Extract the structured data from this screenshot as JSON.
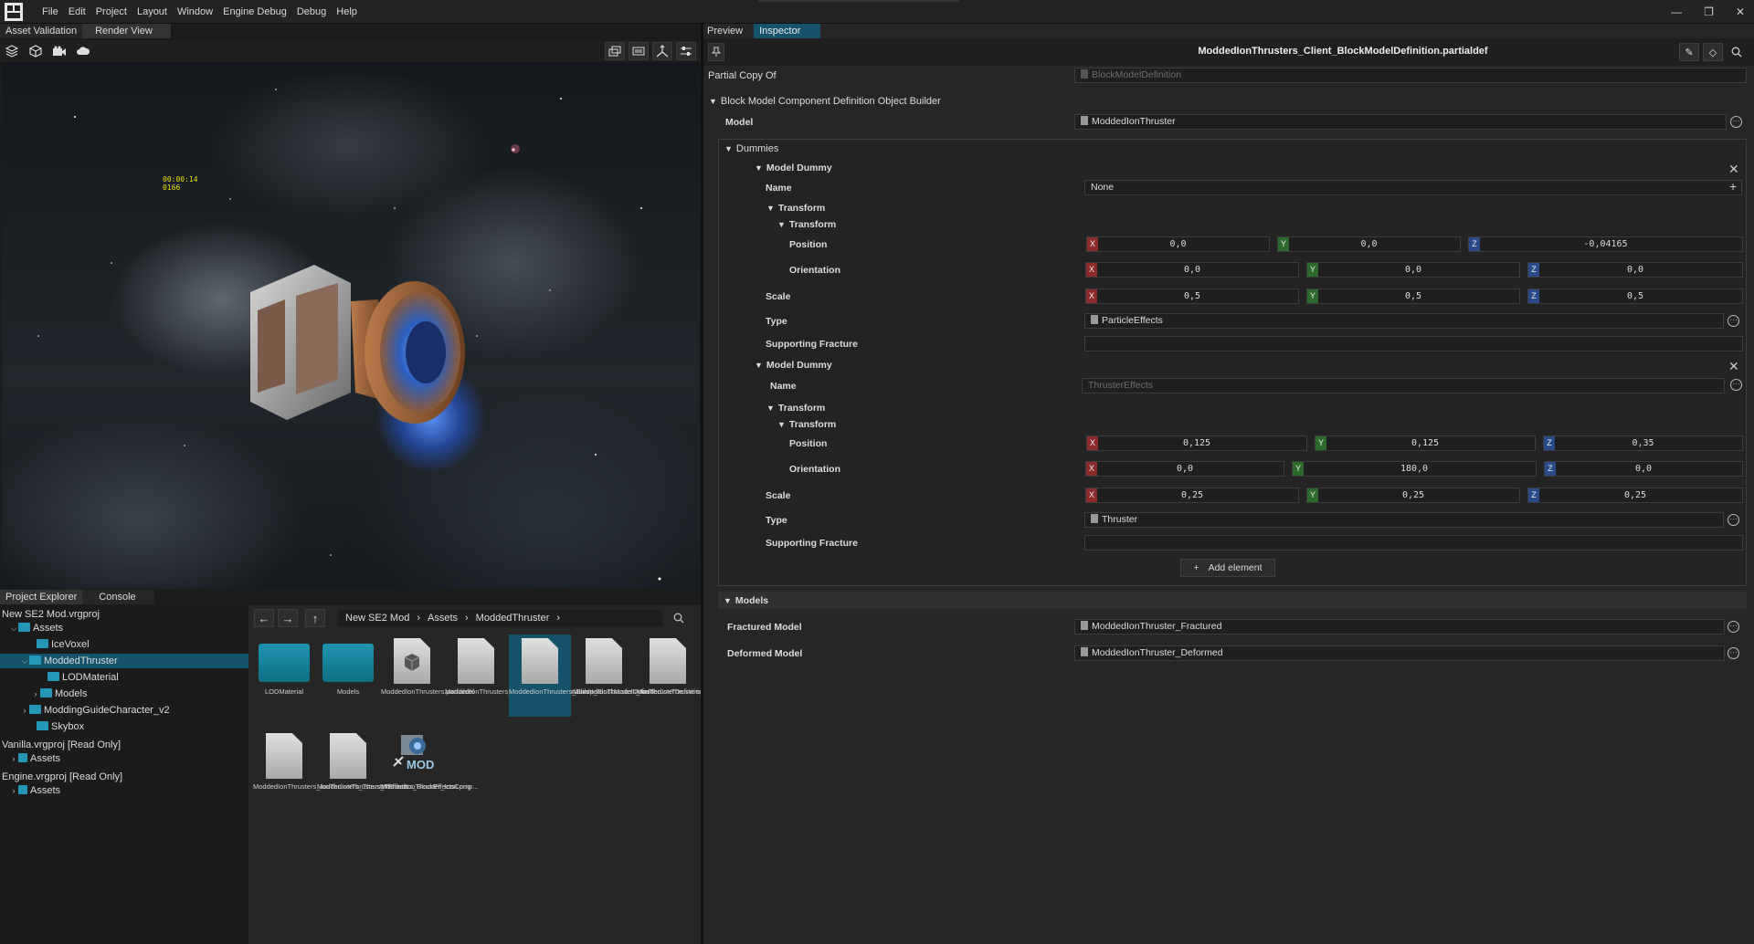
{
  "menu": [
    "File",
    "Edit",
    "Project",
    "Layout",
    "Window",
    "Engine Debug",
    "Debug",
    "Help"
  ],
  "window_controls": [
    "—",
    "❐",
    "✕"
  ],
  "viewport_tabs": [
    "Asset Validation",
    "Render View"
  ],
  "viewport": {
    "hud_line1": "00:00:14",
    "hud_line2": "0166",
    "left_tools": [
      "layers-icon",
      "cube-icon",
      "camera-icon",
      "cloud-icon"
    ],
    "right_tools": [
      "stack-icon",
      "keyboard-icon",
      "axes-icon",
      "sliders-icon"
    ]
  },
  "explorer_tabs": [
    "Project Explorer",
    "Console"
  ],
  "tree": {
    "project1": "New SE2 Mod.vrgproj",
    "assets1": "Assets",
    "icevoxel": "IceVoxel",
    "modded": "ModdedThruster",
    "lodmaterial": "LODMaterial",
    "models": "Models",
    "moddingguide": "ModdingGuideCharacter_v2",
    "skybox": "Skybox",
    "project2": "Vanilla.vrgproj [Read Only]",
    "assets2": "Assets",
    "project3": "Engine.vrgproj [Read Only]",
    "assets3": "Assets"
  },
  "browser": {
    "crumbs": [
      "New SE2 Mod",
      "Assets",
      "ModdedThruster"
    ],
    "items": [
      {
        "label": "LODMaterial",
        "kind": "folder"
      },
      {
        "label": "Models",
        "kind": "folder"
      },
      {
        "label": "ModdedIonThrusters.partialdef",
        "kind": "cube"
      },
      {
        "label": "ModdedIonThrusters_BreakableBlockDefinition.par...",
        "kind": "doc"
      },
      {
        "label": "ModdedIonThrusters_Client_BlockModelDefinition....",
        "kind": "doc"
      },
      {
        "label": "ModdedIonThrusters_IonThrusterDefinition.partiald...",
        "kind": "doc"
      },
      {
        "label": "ModdedIonThrusters_IonThrustersPowerableBlock...",
        "kind": "doc"
      },
      {
        "label": "ModdedIonThrusters_IonThrusters_ThrusterEffects...",
        "kind": "doc"
      },
      {
        "label": "ModdedIonThrusters_Thrusters_BlockEffectsComp...",
        "kind": "doc"
      },
      {
        "label": "ModdedIonThruster_Icon.png",
        "kind": "mod"
      }
    ],
    "mod_text": "MOD"
  },
  "inspector_tabs": [
    "Preview",
    "Inspector"
  ],
  "inspector": {
    "title": "ModdedIonThrusters_Client_BlockModelDefinition.partialdef",
    "partial_copy_label": "Partial Copy Of",
    "partial_copy_value": "BlockModelDefinition",
    "builder_label": "Block Model Component Definition Object Builder",
    "model_label": "Model",
    "model_value": "ModdedIonThruster",
    "dummies_label": "Dummies",
    "model_dummy_label": "Model Dummy",
    "name_label": "Name",
    "transform_label": "Transform",
    "position_label": "Position",
    "orientation_label": "Orientation",
    "scale_label": "Scale",
    "type_label": "Type",
    "fracture_label": "Supporting Fracture",
    "d1": {
      "name": "None",
      "position": [
        "0,0",
        "0,0",
        "-0,04165"
      ],
      "orientation": [
        "0,0",
        "0,0",
        "0,0"
      ],
      "scale": [
        "0,5",
        "0,5",
        "0,5"
      ],
      "type": "ParticleEffects"
    },
    "d2": {
      "name_placeholder": "ThrusterEffects",
      "position": [
        "0,125",
        "0,125",
        "0,35"
      ],
      "orientation": [
        "0,0",
        "180,0",
        "0,0"
      ],
      "scale": [
        "0,25",
        "0,25",
        "0,25"
      ],
      "type": "Thruster"
    },
    "add_element": "Add element",
    "models_label": "Models",
    "fractured_label": "Fractured Model",
    "fractured_value": "ModdedIonThruster_Fractured",
    "deformed_label": "Deformed Model",
    "deformed_value": "ModdedIonThruster_Deformed",
    "axis": [
      "X",
      "Y",
      "Z"
    ]
  }
}
